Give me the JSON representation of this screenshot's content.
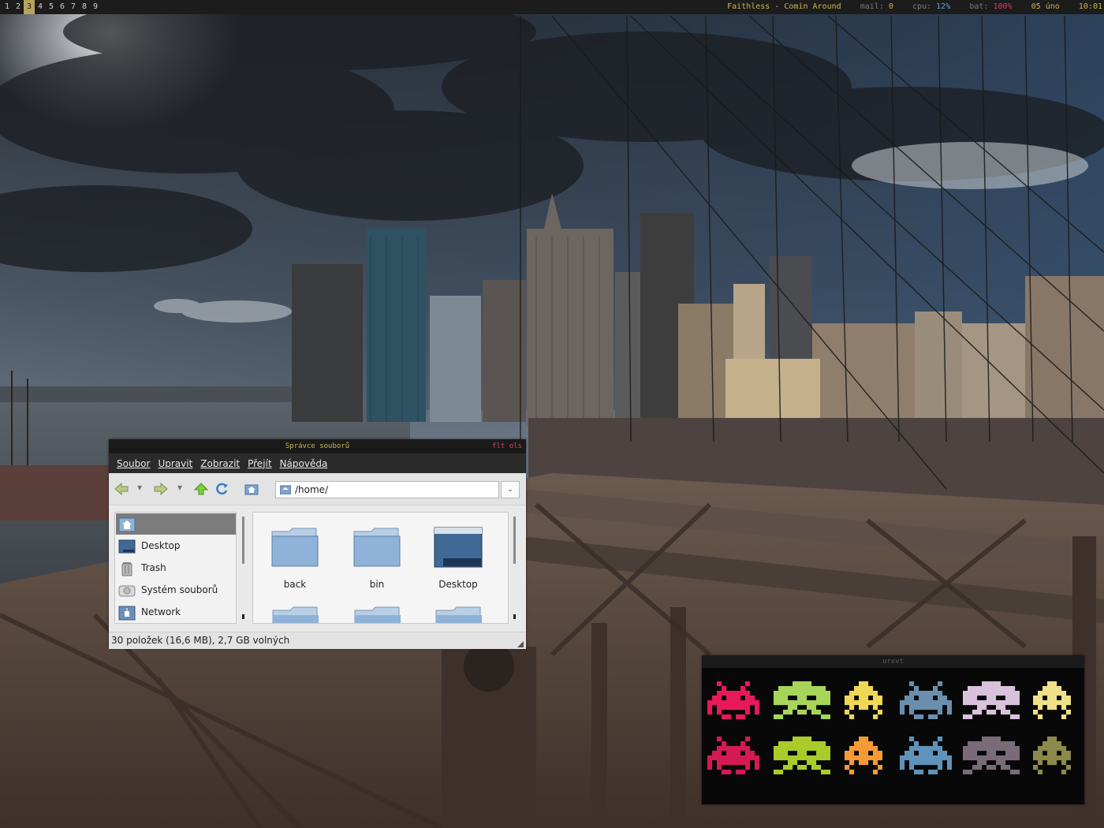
{
  "topbar": {
    "workspaces": [
      "1",
      "2",
      "3",
      "4",
      "5",
      "6",
      "7",
      "8",
      "9"
    ],
    "active_workspace": "3",
    "song": "Faithless - Comin Around",
    "mail_label": "mail:",
    "mail_value": "0",
    "cpu_label": "cpu:",
    "cpu_value": "12%",
    "bat_label": "bat:",
    "bat_value": "100%",
    "date": "05 úno",
    "time": "10:01"
  },
  "file_manager": {
    "title": "Správce souborů",
    "tags": "flt ols",
    "menu": [
      "Soubor",
      "Upravit",
      "Zobrazit",
      "Přejít",
      "Nápověda"
    ],
    "location": "/home/",
    "sidebar": [
      {
        "label": "",
        "icon": "home-icon"
      },
      {
        "label": "Desktop",
        "icon": "desktop-icon"
      },
      {
        "label": "Trash",
        "icon": "trash-icon"
      },
      {
        "label": "Systém souborů",
        "icon": "drive-icon"
      },
      {
        "label": "Network",
        "icon": "network-icon"
      }
    ],
    "files": [
      {
        "name": "back",
        "icon": "folder-icon"
      },
      {
        "name": "bin",
        "icon": "folder-icon"
      },
      {
        "name": "Desktop",
        "icon": "desktop-folder-icon"
      }
    ],
    "status": "30 položek (16,6 MB), 2,7 GB volných"
  },
  "terminal": {
    "title": "urxvt",
    "invader_colors": [
      [
        "#e8195a",
        "#a6d55a",
        "#f0d755",
        "#6a8fae",
        "#d9c2dc",
        "#f0e08a"
      ],
      [
        "#d41a55",
        "#a9cc2a",
        "#f59a35",
        "#5f93b9",
        "#7a6b78",
        "#8b8a4a"
      ]
    ]
  }
}
